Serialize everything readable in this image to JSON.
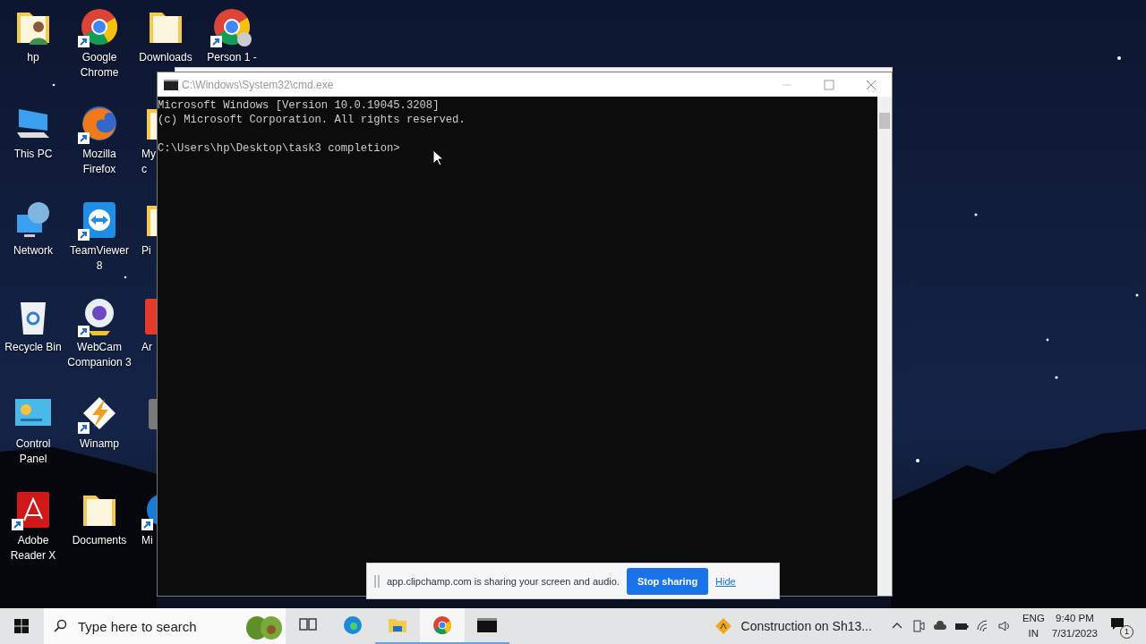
{
  "desktop_icons": [
    {
      "label": "hp",
      "kind": "user-folder",
      "shortcut": false,
      "clipped": false
    },
    {
      "label": "This PC",
      "kind": "pc",
      "shortcut": false,
      "clipped": false
    },
    {
      "label": "Network",
      "kind": "network",
      "shortcut": false,
      "clipped": false
    },
    {
      "label": "Recycle Bin",
      "kind": "recycle",
      "shortcut": false,
      "clipped": false
    },
    {
      "label": "Control Panel",
      "kind": "control-panel",
      "shortcut": false,
      "clipped": false
    },
    {
      "label": "Adobe Reader X",
      "kind": "pdf",
      "shortcut": true,
      "clipped": false
    },
    {
      "label": "Google Chrome",
      "kind": "chrome",
      "shortcut": true,
      "clipped": false
    },
    {
      "label": "Mozilla Firefox",
      "kind": "firefox",
      "shortcut": true,
      "clipped": false
    },
    {
      "label": "TeamViewer 8",
      "kind": "teamviewer",
      "shortcut": true,
      "clipped": false
    },
    {
      "label": "WebCam Companion 3",
      "kind": "webcam",
      "shortcut": true,
      "clipped": false
    },
    {
      "label": "Winamp",
      "kind": "winamp",
      "shortcut": true,
      "clipped": false
    },
    {
      "label": "Documents",
      "kind": "folder",
      "shortcut": false,
      "clipped": false
    },
    {
      "label": "Downloads",
      "kind": "folder",
      "shortcut": false,
      "clipped": false
    },
    {
      "label": "My c",
      "kind": "folder",
      "shortcut": false,
      "clipped": true
    },
    {
      "label": "Pi",
      "kind": "folder",
      "shortcut": false,
      "clipped": true
    },
    {
      "label": "Ar",
      "kind": "red-app",
      "shortcut": false,
      "clipped": true
    },
    {
      "kind": "grey-app",
      "shortcut": false,
      "clipped": true
    },
    {
      "label": "Mi",
      "kind": "blue-app",
      "shortcut": true,
      "clipped": true
    },
    {
      "label": "Person 1 -",
      "kind": "chrome-person",
      "shortcut": true,
      "clipped": false
    }
  ],
  "console_window": {
    "title": "C:\\Windows\\System32\\cmd.exe",
    "lines": [
      {
        "kind": "output",
        "text": "Microsoft Windows [Version 10.0.19045.3208]"
      },
      {
        "kind": "output",
        "text": "(c) Microsoft Corporation. All rights reserved."
      },
      {
        "kind": "prompt",
        "text": "C:\\Users\\hp\\Desktop\\task3 completion>"
      }
    ]
  },
  "share_bar": {
    "message": "app.clipchamp.com is sharing your screen and audio.",
    "stop_button": "Stop sharing",
    "hide_link": "Hide"
  },
  "taskbar": {
    "search": {
      "placeholder": "Type here to search"
    },
    "apps": [
      {
        "kind": "task-view",
        "selected": false,
        "running": false
      },
      {
        "kind": "edge",
        "selected": false,
        "running": false
      },
      {
        "kind": "explorer",
        "selected": false,
        "running": true
      },
      {
        "kind": "chrome",
        "selected": true,
        "running": true
      },
      {
        "kind": "console",
        "selected": false,
        "running": true
      }
    ],
    "weather": "Construction on Sh13...",
    "language": [
      "ENG",
      "IN"
    ],
    "time": "9:40 PM",
    "date": "7/31/2023",
    "notification_count": "1"
  }
}
